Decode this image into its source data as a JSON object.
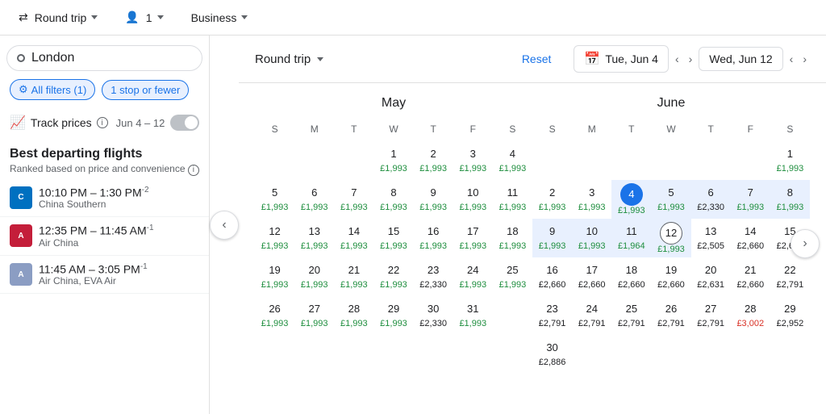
{
  "topBar": {
    "tripType": "Round trip",
    "passengers": "1",
    "cabinClass": "Business"
  },
  "leftPanel": {
    "searchPlaceholder": "London",
    "filters": {
      "allFilters": "All filters (1)",
      "stopFilter": "1 stop or fewer"
    },
    "trackPrices": {
      "label": "Track prices",
      "dateRange": "Jun 4 – 12"
    },
    "bestFlights": {
      "title": "Best departing flights",
      "subtitle": "Ranked based on price and convenience"
    },
    "flights": [
      {
        "time": "10:10 PM – 1:30 PM",
        "sup": "-2",
        "airline": "China Southern",
        "color": "#0070C0"
      },
      {
        "time": "12:35 PM – 11:45 AM",
        "sup": "-1",
        "airline": "Air China",
        "color": "#C41E3A"
      },
      {
        "time": "11:45 AM – 3:05 PM",
        "sup": "-1",
        "airline": "Air China, EVA Air",
        "color": "#8B9DC3"
      }
    ]
  },
  "calendarHeader": {
    "tripTypeLabel": "Round trip",
    "resetLabel": "Reset",
    "departDate": "Tue, Jun 4",
    "returnDate": "Wed, Jun 12"
  },
  "may": {
    "title": "May",
    "days": [
      "S",
      "M",
      "T",
      "W",
      "T",
      "F",
      "S"
    ],
    "startOffset": 3,
    "weeks": [
      [
        {
          "d": "",
          "p": ""
        },
        {
          "d": "",
          "p": ""
        },
        {
          "d": "",
          "p": ""
        },
        {
          "d": "1",
          "p": "£1,993",
          "level": "low"
        },
        {
          "d": "2",
          "p": "£1,993",
          "level": "low"
        },
        {
          "d": "3",
          "p": "£1,993",
          "level": "low"
        },
        {
          "d": "4",
          "p": "£1,993",
          "level": "low"
        }
      ],
      [
        {
          "d": "5",
          "p": "£1,993",
          "level": "low"
        },
        {
          "d": "6",
          "p": "£1,993",
          "level": "low"
        },
        {
          "d": "7",
          "p": "£1,993",
          "level": "low"
        },
        {
          "d": "8",
          "p": "£1,993",
          "level": "low"
        },
        {
          "d": "9",
          "p": "£1,993",
          "level": "low"
        },
        {
          "d": "10",
          "p": "£1,993",
          "level": "low"
        },
        {
          "d": "11",
          "p": "£1,993",
          "level": "low"
        }
      ],
      [
        {
          "d": "12",
          "p": "£1,993",
          "level": "low"
        },
        {
          "d": "13",
          "p": "£1,993",
          "level": "low"
        },
        {
          "d": "14",
          "p": "£1,993",
          "level": "low"
        },
        {
          "d": "15",
          "p": "£1,993",
          "level": "low"
        },
        {
          "d": "16",
          "p": "£1,993",
          "level": "low"
        },
        {
          "d": "17",
          "p": "£1,993",
          "level": "low"
        },
        {
          "d": "18",
          "p": "£1,993",
          "level": "low"
        }
      ],
      [
        {
          "d": "19",
          "p": "£1,993",
          "level": "low"
        },
        {
          "d": "20",
          "p": "£1,993",
          "level": "low"
        },
        {
          "d": "21",
          "p": "£1,993",
          "level": "low"
        },
        {
          "d": "22",
          "p": "£1,993",
          "level": "low"
        },
        {
          "d": "23",
          "p": "£2,330",
          "level": "medium"
        },
        {
          "d": "24",
          "p": "£1,993",
          "level": "low"
        },
        {
          "d": "25",
          "p": "£1,993",
          "level": "low"
        }
      ],
      [
        {
          "d": "26",
          "p": "£1,993",
          "level": "low"
        },
        {
          "d": "27",
          "p": "£1,993",
          "level": "low"
        },
        {
          "d": "28",
          "p": "£1,993",
          "level": "low"
        },
        {
          "d": "29",
          "p": "£1,993",
          "level": "low"
        },
        {
          "d": "30",
          "p": "£2,330",
          "level": "medium"
        },
        {
          "d": "31",
          "p": "£1,993",
          "level": "low"
        },
        {
          "d": "",
          "p": ""
        }
      ]
    ]
  },
  "june": {
    "title": "June",
    "days": [
      "S",
      "M",
      "T",
      "W",
      "T",
      "F",
      "S"
    ],
    "weeks": [
      [
        {
          "d": "",
          "p": ""
        },
        {
          "d": "",
          "p": ""
        },
        {
          "d": "",
          "p": ""
        },
        {
          "d": "",
          "p": ""
        },
        {
          "d": "",
          "p": ""
        },
        {
          "d": "",
          "p": ""
        },
        {
          "d": "1",
          "p": "£1,993",
          "level": "low"
        }
      ],
      [
        {
          "d": "2",
          "p": "£1,993",
          "level": "low"
        },
        {
          "d": "3",
          "p": "£1,993",
          "level": "low"
        },
        {
          "d": "4",
          "p": "£1,993",
          "level": "low",
          "selected": "depart"
        },
        {
          "d": "5",
          "p": "£1,993",
          "level": "low",
          "inRange": true
        },
        {
          "d": "6",
          "p": "£2,330",
          "level": "medium",
          "inRange": true
        },
        {
          "d": "7",
          "p": "£1,993",
          "level": "low",
          "inRange": true
        },
        {
          "d": "8",
          "p": "£1,993",
          "level": "low",
          "inRange": true
        }
      ],
      [
        {
          "d": "9",
          "p": "£1,993",
          "level": "low",
          "inRange": true
        },
        {
          "d": "10",
          "p": "£1,993",
          "level": "low",
          "inRange": true
        },
        {
          "d": "11",
          "p": "£1,964",
          "level": "low",
          "inRange": true
        },
        {
          "d": "12",
          "p": "£1,993",
          "level": "low",
          "selected": "return"
        },
        {
          "d": "13",
          "p": "£2,505",
          "level": "medium"
        },
        {
          "d": "14",
          "p": "£2,660",
          "level": "medium"
        },
        {
          "d": "15",
          "p": "£2,631",
          "level": "medium"
        }
      ],
      [
        {
          "d": "16",
          "p": "£2,660",
          "level": "medium"
        },
        {
          "d": "17",
          "p": "£2,660",
          "level": "medium"
        },
        {
          "d": "18",
          "p": "£2,660",
          "level": "medium"
        },
        {
          "d": "19",
          "p": "£2,660",
          "level": "medium"
        },
        {
          "d": "20",
          "p": "£2,631",
          "level": "medium"
        },
        {
          "d": "21",
          "p": "£2,660",
          "level": "medium"
        },
        {
          "d": "22",
          "p": "£2,791",
          "level": "medium"
        }
      ],
      [
        {
          "d": "23",
          "p": "£2,791",
          "level": "medium"
        },
        {
          "d": "24",
          "p": "£2,791",
          "level": "medium"
        },
        {
          "d": "25",
          "p": "£2,791",
          "level": "medium"
        },
        {
          "d": "26",
          "p": "£2,791",
          "level": "medium"
        },
        {
          "d": "27",
          "p": "£2,791",
          "level": "medium"
        },
        {
          "d": "28",
          "p": "£3,002",
          "level": "high"
        },
        {
          "d": "29",
          "p": "£2,952",
          "level": "medium"
        }
      ],
      [
        {
          "d": "30",
          "p": "£2,886",
          "level": "medium"
        },
        {
          "d": "",
          "p": ""
        },
        {
          "d": "",
          "p": ""
        },
        {
          "d": "",
          "p": ""
        },
        {
          "d": "",
          "p": ""
        },
        {
          "d": "",
          "p": ""
        },
        {
          "d": "",
          "p": ""
        }
      ]
    ]
  }
}
